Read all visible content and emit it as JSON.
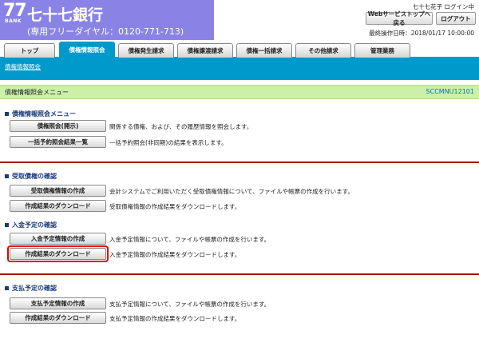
{
  "header": {
    "logo_number": "77",
    "logo_sub": "BANK",
    "bank_name": "七十七銀行",
    "phone_line": "(専用フリーダイヤル：0120-771-713)",
    "user_status": "七十七花子 ログイン中",
    "portal_button": "Webサービストップへ戻る",
    "logout_button": "ログアウト",
    "last_operation": "最終操作日時：2018/01/17 10:00:00",
    "brand_color": "#8a83e6"
  },
  "tabs": [
    {
      "label": "トップ",
      "active": false
    },
    {
      "label": "債権情報照会",
      "active": true
    },
    {
      "label": "債権発生請求",
      "active": false
    },
    {
      "label": "債権譲渡請求",
      "active": false
    },
    {
      "label": "債権一括請求",
      "active": false
    },
    {
      "label": "その他請求",
      "active": false
    },
    {
      "label": "管理業務",
      "active": false
    }
  ],
  "subnav": {
    "link": "債権情報照会"
  },
  "page": {
    "title": "債権情報照会メニュー",
    "screen_id": "SCCMNU12101"
  },
  "sections": [
    {
      "heading": "債権情報照会メニュー",
      "items": [
        {
          "button": "債権照会(開示)",
          "description": "関係する債権、および、その履歴情報を照会します。"
        },
        {
          "button": "一括予約照会結果一覧",
          "description": "一括予約照会(非同期)の結果を表示します。"
        }
      ]
    },
    {
      "heading": "受取債権の確認",
      "items": [
        {
          "button": "受取債権情報の作成",
          "description": "会計システムでご利用いただく受取債権情報について、ファイルや帳票の作成を行います。"
        },
        {
          "button": "作成結果のダウンロード",
          "description": "受取債権情報の作成結果をダウンロードします。"
        }
      ]
    },
    {
      "heading": "入金予定の確認",
      "items": [
        {
          "button": "入金予定情報の作成",
          "description": "入金予定情報について、ファイルや帳票の作成を行います。"
        },
        {
          "button": "作成結果のダウンロード",
          "description": "入金予定情報の作成結果をダウンロードします。"
        }
      ]
    },
    {
      "heading": "支払予定の確認",
      "items": [
        {
          "button": "支払予定情報の作成",
          "description": "支払予定情報について、ファイルや帳票の作成を行います。"
        },
        {
          "button": "作成結果のダウンロード",
          "description": "支払予定情報の作成結果をダウンロードします。"
        }
      ]
    }
  ],
  "colors": {
    "accent": "#0099cc",
    "title_bar": "#ccf0a8",
    "divider": "#b00000",
    "highlight": "#e60000"
  }
}
